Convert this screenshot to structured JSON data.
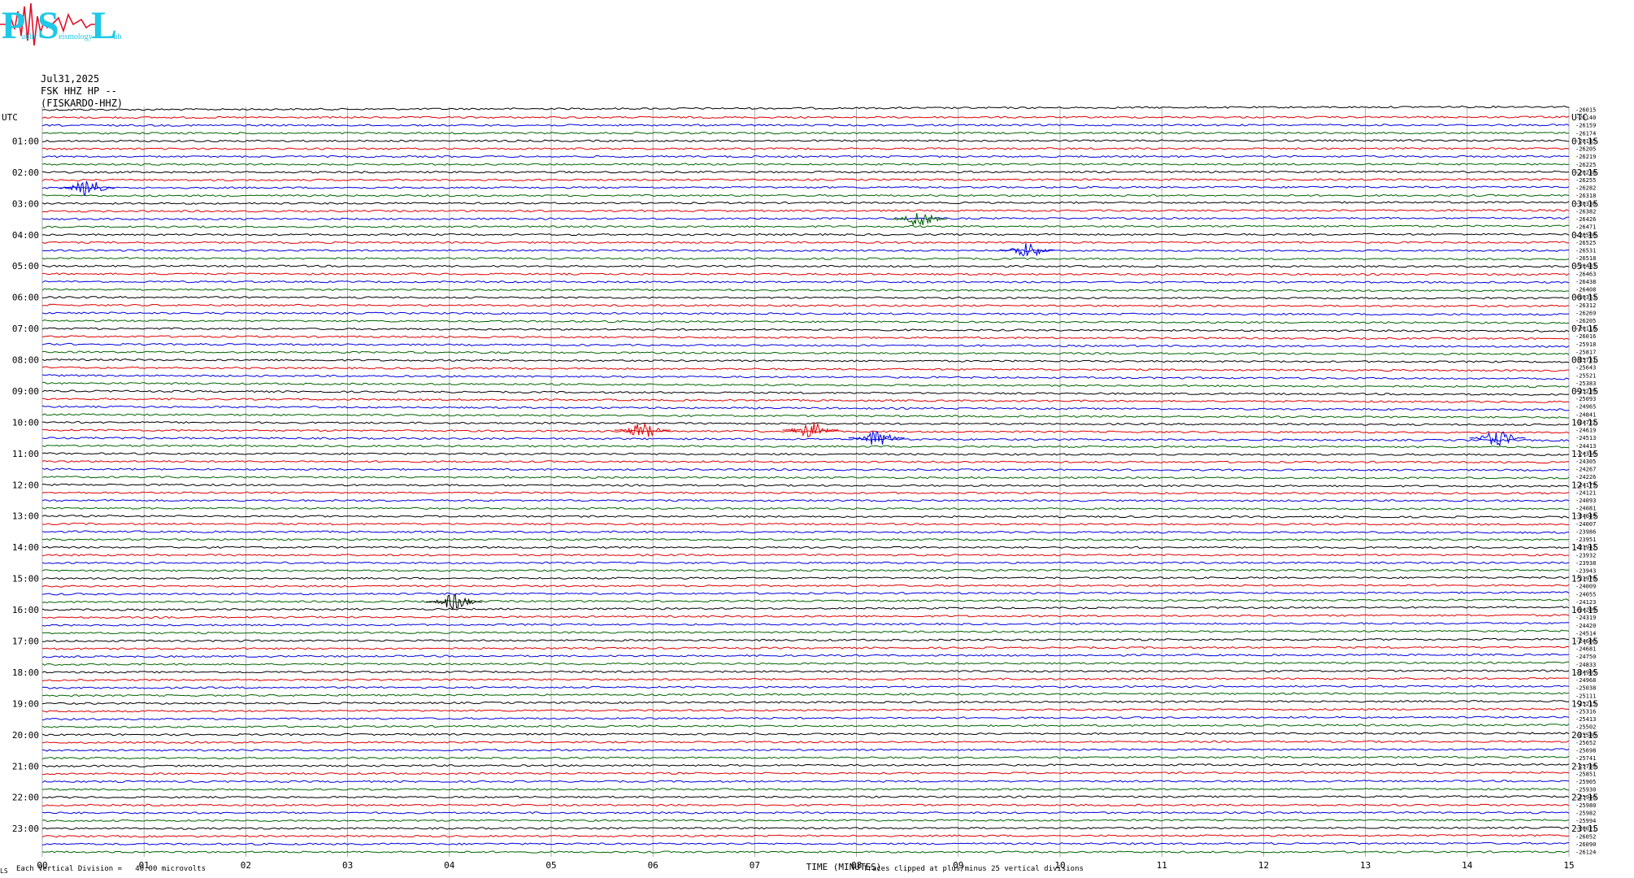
{
  "logo": {
    "letters": [
      "P",
      "S",
      "L"
    ],
    "subtitle_words": [
      "ublic",
      "eismology",
      "ab"
    ],
    "color": "#1ec8e6",
    "signal_color": "#e0102a"
  },
  "header": {
    "date": "Jul31,2025",
    "station": "FSK HHZ HP --",
    "station_name": "(FISKARDO-HHZ)"
  },
  "chart_data": {
    "type": "line",
    "title": "",
    "xlabel": "TIME (MINUTES)",
    "ylabel": "",
    "xlim": [
      0,
      15
    ],
    "x_ticks": [
      "00",
      "01",
      "02",
      "03",
      "04",
      "05",
      "06",
      "07",
      "08",
      "09",
      "10",
      "11",
      "12",
      "13",
      "14",
      "15"
    ],
    "left_axis_title": "UTC",
    "right_axis_title": "UTC",
    "left_hour_labels": [
      "01:00",
      "02:00",
      "03:00",
      "04:00",
      "05:00",
      "06:00",
      "07:00",
      "08:00",
      "09:00",
      "10:00",
      "11:00",
      "12:00",
      "13:00",
      "14:00",
      "15:00",
      "16:00",
      "17:00",
      "18:00",
      "19:00",
      "20:00",
      "21:00",
      "22:00",
      "23:00"
    ],
    "right_hour_labels": [
      "01:15",
      "02:15",
      "03:15",
      "04:15",
      "05:15",
      "06:15",
      "07:15",
      "08:15",
      "09:15",
      "10:15",
      "11:15",
      "12:15",
      "13:15",
      "14:15",
      "15:15",
      "16:15",
      "17:15",
      "18:15",
      "19:15",
      "20:15",
      "21:15",
      "22:15",
      "23:15"
    ],
    "trace_colors": [
      "#000000",
      "#e00000",
      "#0000e0",
      "#006400"
    ],
    "trace_count": 96,
    "minutes_per_trace": 15,
    "trace_offsets": [
      "-26015",
      "-26140",
      "-26159",
      "-26174",
      "-26185",
      "-26205",
      "-26219",
      "-26225",
      "-26238",
      "-26255",
      "-26282",
      "-26318",
      "-26330",
      "-26382",
      "-26426",
      "-26471",
      "-26508",
      "-26525",
      "-26531",
      "-26518",
      "-26483",
      "-26463",
      "-26438",
      "-26408",
      "-26353",
      "-26312",
      "-26269",
      "-26205",
      "-26118",
      "-26016",
      "-25918",
      "-25817",
      "-25731",
      "-25643",
      "-25521",
      "-25383",
      "-25239",
      "-25093",
      "-24965",
      "-24841",
      "-24722",
      "-24619",
      "-24513",
      "-24413",
      "-24356",
      "-24305",
      "-24267",
      "-24226",
      "-24179",
      "-24121",
      "-24093",
      "-24081",
      "-24049",
      "-24007",
      "-23986",
      "-23951",
      "-23942",
      "-23932",
      "-23938",
      "-23943",
      "-23970",
      "-24009",
      "-24055",
      "-24123",
      "-24209",
      "-24319",
      "-24420",
      "-24514",
      "-24606",
      "-24681",
      "-24750",
      "-24833",
      "-24905",
      "-24968",
      "-25038",
      "-25111",
      "-25215",
      "-25316",
      "-25413",
      "-25502",
      "-25586",
      "-25652",
      "-25698",
      "-25741",
      "-25789",
      "-25851",
      "-25905",
      "-25930",
      "-25946",
      "-25980",
      "-25982",
      "-25994",
      "-26021",
      "-26052",
      "-26090",
      "-26124"
    ],
    "events": [
      {
        "trace": 10,
        "minute": 0.45,
        "color": "#0000e0"
      },
      {
        "trace": 14,
        "minute": 8.62,
        "color": "#006400"
      },
      {
        "trace": 18,
        "minute": 9.68,
        "color": "#0000e0"
      },
      {
        "trace": 41,
        "minute": 5.9,
        "color": "#e00000"
      },
      {
        "trace": 41,
        "minute": 7.55,
        "color": "#e00000"
      },
      {
        "trace": 42,
        "minute": 8.2,
        "color": "#0000e0"
      },
      {
        "trace": 42,
        "minute": 14.3,
        "color": "#0000e0"
      },
      {
        "trace": 63,
        "minute": 4.05,
        "color": "#000000"
      }
    ],
    "grid": true
  },
  "footer": {
    "left_mark": "LS",
    "vertical_division": "Each Vertical Division =   40.00 microvolts",
    "clip_note": "Traces clipped at plus/minus 25 vertical divisions"
  }
}
